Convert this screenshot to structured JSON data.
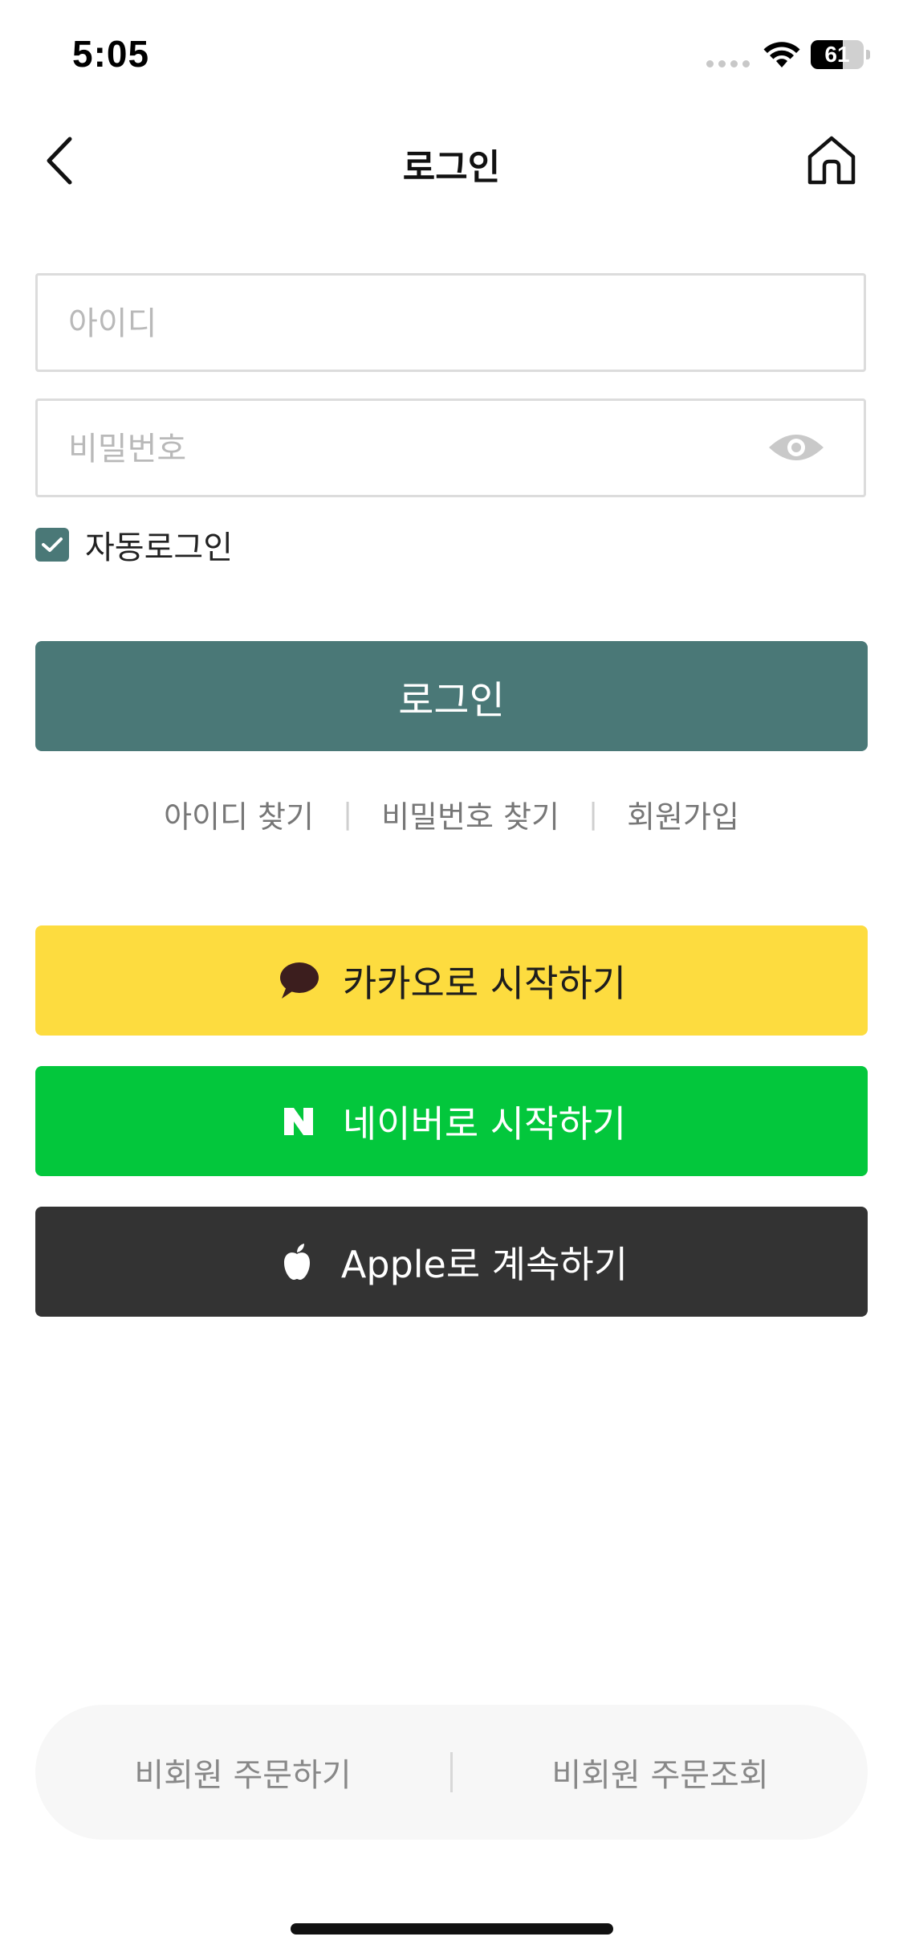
{
  "status_bar": {
    "time": "5:05",
    "battery_level": 61,
    "battery_label": "61"
  },
  "header": {
    "title": "로그인",
    "back_icon": "chevron-left-icon",
    "home_icon": "home-icon"
  },
  "form": {
    "id_placeholder": "아이디",
    "id_value": "",
    "password_placeholder": "비밀번호",
    "password_value": "",
    "password_toggle_icon": "eye-icon",
    "auto_login_label": "자동로그인",
    "auto_login_checked": true,
    "login_label": "로그인"
  },
  "links": {
    "find_id": "아이디 찾기",
    "find_password": "비밀번호 찾기",
    "signup": "회원가입",
    "separator": "|"
  },
  "social": {
    "kakao_label": "카카오로 시작하기",
    "naver_label": "네이버로 시작하기",
    "apple_label": "Apple로 계속하기"
  },
  "guest": {
    "order_label": "비회원 주문하기",
    "order_lookup_label": "비회원 주문조회"
  },
  "colors": {
    "primary": "#4a7877",
    "kakao": "#fddc3f",
    "naver": "#03c73c",
    "apple": "#333333"
  }
}
